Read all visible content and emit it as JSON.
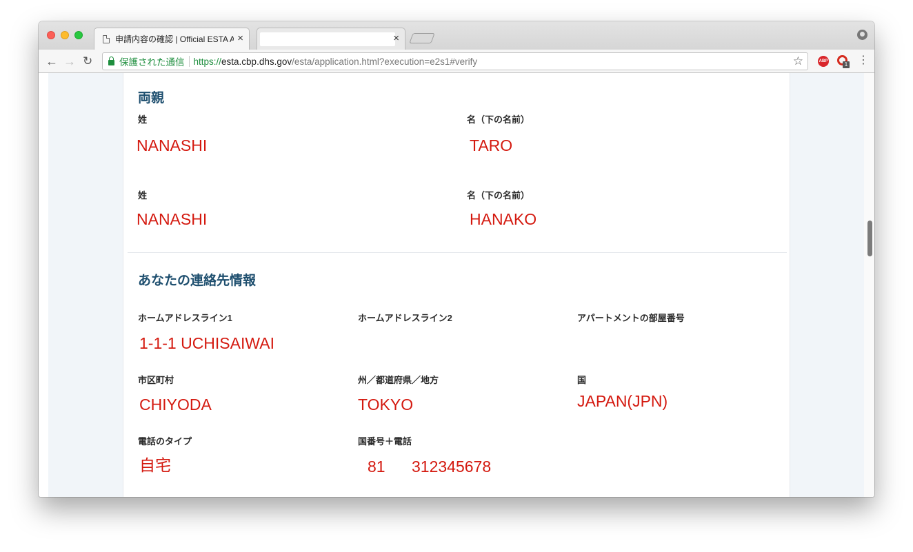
{
  "browser": {
    "active_tab_title": "申請内容の確認 | Official ESTA A",
    "tab_close_glyph": "×",
    "url": {
      "secure_label": "保護された通信",
      "scheme": "https://",
      "host": "esta.cbp.dhs.gov",
      "path": "/esta/application.html?execution=e2s1#verify"
    },
    "extensions": {
      "abp_label": "ABP",
      "badge_count": "1"
    }
  },
  "parents": {
    "heading": "両親",
    "father": {
      "surname_label": "姓",
      "surname_value": "NANASHI",
      "given_label": "名（下の名前）",
      "given_value": "TARO"
    },
    "mother": {
      "surname_label": "姓",
      "surname_value": "NANASHI",
      "given_label": "名（下の名前）",
      "given_value": "HANAKO"
    }
  },
  "contact": {
    "heading": "あなたの連絡先情報",
    "address_line1_label": "ホームアドレスライン1",
    "address_line1_value": "1-1-1 UCHISAIWAI",
    "address_line2_label": "ホームアドレスライン2",
    "apartment_label": "アパートメントの部屋番号",
    "city_label": "市区町村",
    "city_value": "CHIYODA",
    "state_label": "州／都道府県／地方",
    "state_value": "TOKYO",
    "country_label": "国",
    "country_value": "JAPAN(JPN)",
    "phone_type_label": "電話のタイプ",
    "phone_type_value": "自宅",
    "phone_label": "国番号＋電話",
    "phone_country_code": "81",
    "phone_number": "312345678"
  }
}
